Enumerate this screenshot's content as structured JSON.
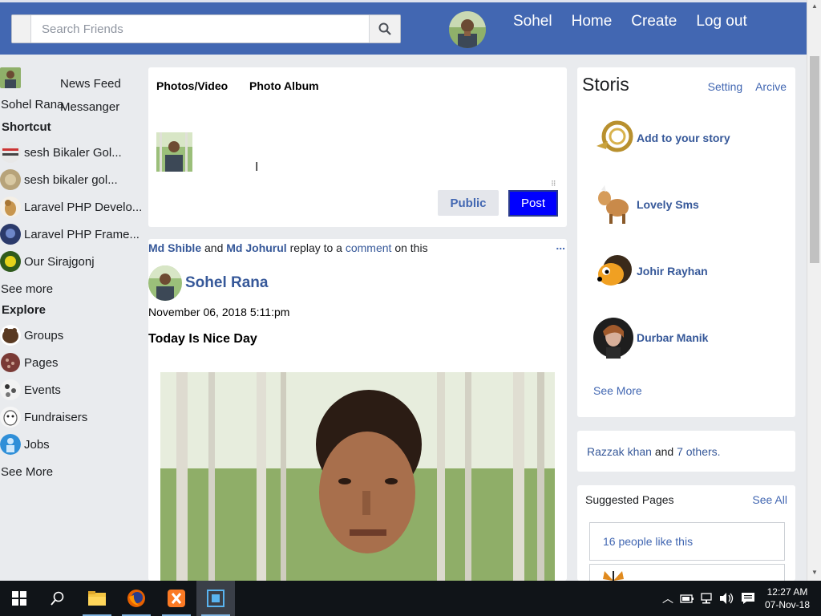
{
  "header": {
    "search_placeholder": "Search Friends",
    "nav": [
      "Sohel",
      "Home",
      "Create",
      "Log out"
    ]
  },
  "sidebar": {
    "profile_name": "Sohel Rana",
    "news_feed": "News Feed",
    "messenger": "Messanger",
    "shortcut_heading": "Shortcut",
    "shortcuts": [
      "sesh Bikaler Gol...",
      "sesh bikaler gol...",
      "Laravel PHP Develo...",
      "Laravel PHP Frame...",
      "Our Sirajgonj"
    ],
    "see_more_1": "See more",
    "explore_heading": "Explore",
    "explore": [
      "Groups",
      "Pages",
      "Events",
      "Fundraisers",
      "Jobs"
    ],
    "see_more_2": "See More"
  },
  "composer": {
    "tab_photos": "Photos/Video",
    "tab_album": "Photo Album",
    "public_label": "Public",
    "post_label": "Post"
  },
  "post": {
    "actor1": "Md Shible",
    "and": "and",
    "actor2": "Md Johurul",
    "action": "replay to a",
    "comment_link": "comment",
    "on_this": "on this",
    "dots": "...",
    "author": "Sohel Rana",
    "date": "November 06, 2018 5:11:pm",
    "title": "Today Is Nice Day"
  },
  "stories": {
    "title": "Storis",
    "setting": "Setting",
    "archive": "Arcive",
    "items": [
      "Add to your story",
      "Lovely Sms",
      "Johir Rayhan",
      "Durbar Manik"
    ],
    "see_more": "See More"
  },
  "friends": {
    "name": "Razzak khan",
    "and": "and",
    "others": "7 others."
  },
  "suggested": {
    "title": "Suggested Pages",
    "see_all": "See All",
    "likes": "16 people like this"
  },
  "taskbar": {
    "time": "12:27 AM",
    "date": "07-Nov-18"
  }
}
